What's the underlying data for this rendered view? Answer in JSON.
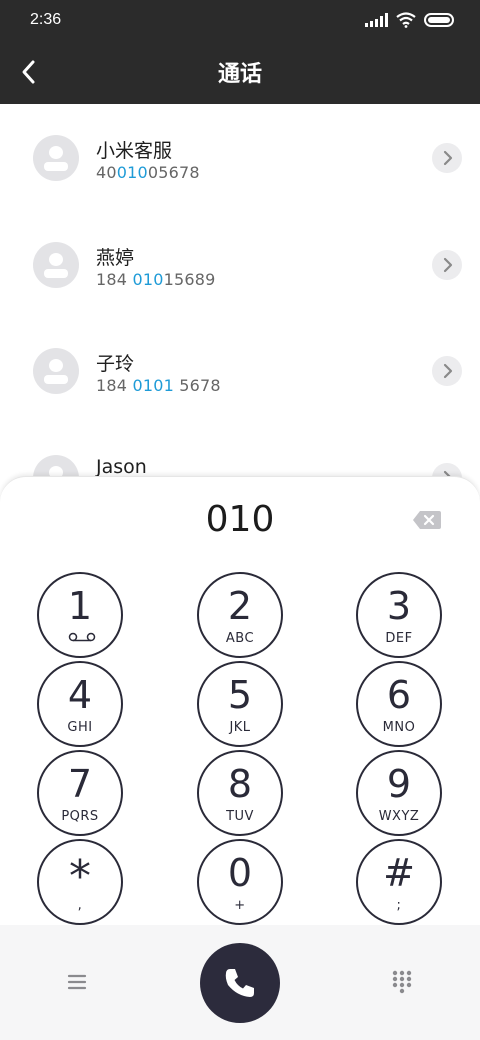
{
  "status_bar": {
    "time": "2:36"
  },
  "header": {
    "title": "通话"
  },
  "contacts": [
    {
      "name": "小米客服",
      "number_parts": [
        "40",
        "010",
        "05678"
      ]
    },
    {
      "name": "燕婷",
      "number_parts": [
        "184 ",
        "010",
        "15689"
      ]
    },
    {
      "name": "子玲",
      "number_parts": [
        "184 ",
        "0101",
        " 5678"
      ]
    },
    {
      "name": "Jason",
      "number_parts": [
        "",
        "",
        ""
      ]
    }
  ],
  "dialer": {
    "input": "010",
    "keys": [
      {
        "digit": "1",
        "letters": ""
      },
      {
        "digit": "2",
        "letters": "ABC"
      },
      {
        "digit": "3",
        "letters": "DEF"
      },
      {
        "digit": "4",
        "letters": "GHI"
      },
      {
        "digit": "5",
        "letters": "JKL"
      },
      {
        "digit": "6",
        "letters": "MNO"
      },
      {
        "digit": "7",
        "letters": "PQRS"
      },
      {
        "digit": "8",
        "letters": "TUV"
      },
      {
        "digit": "9",
        "letters": "WXYZ"
      },
      {
        "digit": "*",
        "letters": ","
      },
      {
        "digit": "0",
        "letters": "+"
      },
      {
        "digit": "#",
        "letters": ";"
      }
    ]
  },
  "colors": {
    "header_bg": "#2b2b2b",
    "highlight": "#1e9bd7",
    "key_ring": "#2a2a38",
    "call_button": "#2c2b3c"
  }
}
